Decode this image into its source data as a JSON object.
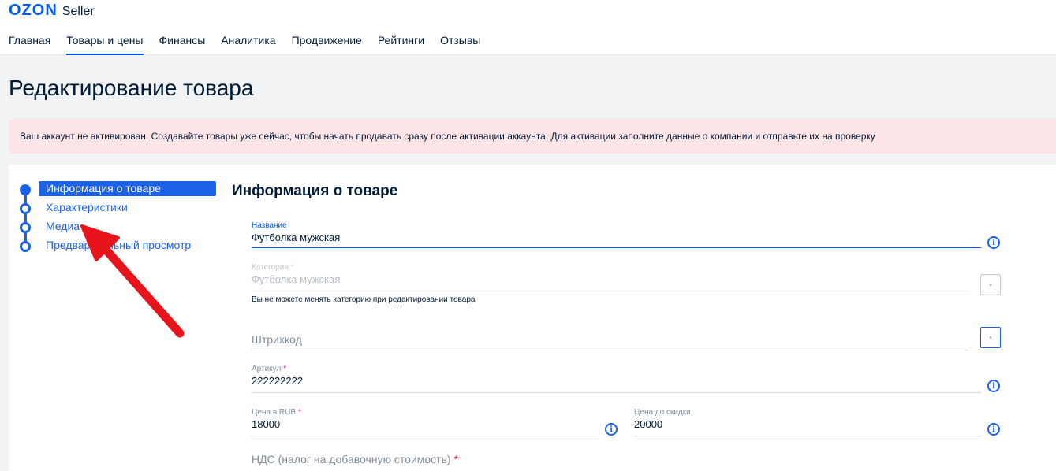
{
  "header": {
    "logo_brand": "OZON",
    "logo_product": "Seller",
    "nav": [
      {
        "label": "Главная"
      },
      {
        "label": "Товары и цены",
        "active": true
      },
      {
        "label": "Финансы"
      },
      {
        "label": "Аналитика"
      },
      {
        "label": "Продвижение"
      },
      {
        "label": "Рейтинги"
      },
      {
        "label": "Отзывы"
      }
    ]
  },
  "page": {
    "title": "Редактирование товара",
    "alert": "Ваш аккаунт не активирован. Создавайте товары уже сейчас, чтобы начать продавать сразу после активации аккаунта. Для активации заполните данные о компании и отправьте их на проверку"
  },
  "stepper": {
    "steps": [
      {
        "label": "Информация о товаре",
        "active": true
      },
      {
        "label": "Характеристики"
      },
      {
        "label": "Медиа"
      },
      {
        "label": "Предварительный просмотр"
      }
    ]
  },
  "form": {
    "section_title": "Информация о товаре",
    "name": {
      "label": "Название",
      "value": "Футболка мужская"
    },
    "category": {
      "label": "Категория",
      "required_mark": "*",
      "value": "Футболка мужская",
      "hint": "Вы не можете менять категорию при редактировании товара"
    },
    "barcode": {
      "placeholder": "Штрихкод"
    },
    "article": {
      "label": "Артикул",
      "required_mark": "*",
      "value": "222222222"
    },
    "price": {
      "label": "Цена в RUB",
      "required_mark": "*",
      "value": "18000"
    },
    "old_price": {
      "label": "Цена до скидки",
      "value": "20000"
    },
    "vat": {
      "label": "НДС (налог на добавочную стоимость)",
      "required_mark": "*"
    }
  },
  "icons": {
    "info": "info-icon",
    "menu": "menu-dots-icon",
    "arrow": "red-pointer-arrow"
  },
  "colors": {
    "brand": "#005bff",
    "step": "#1b62e9",
    "alert_bg": "#fce4e7",
    "required": "#f91155",
    "arrow": "#e8141b"
  }
}
